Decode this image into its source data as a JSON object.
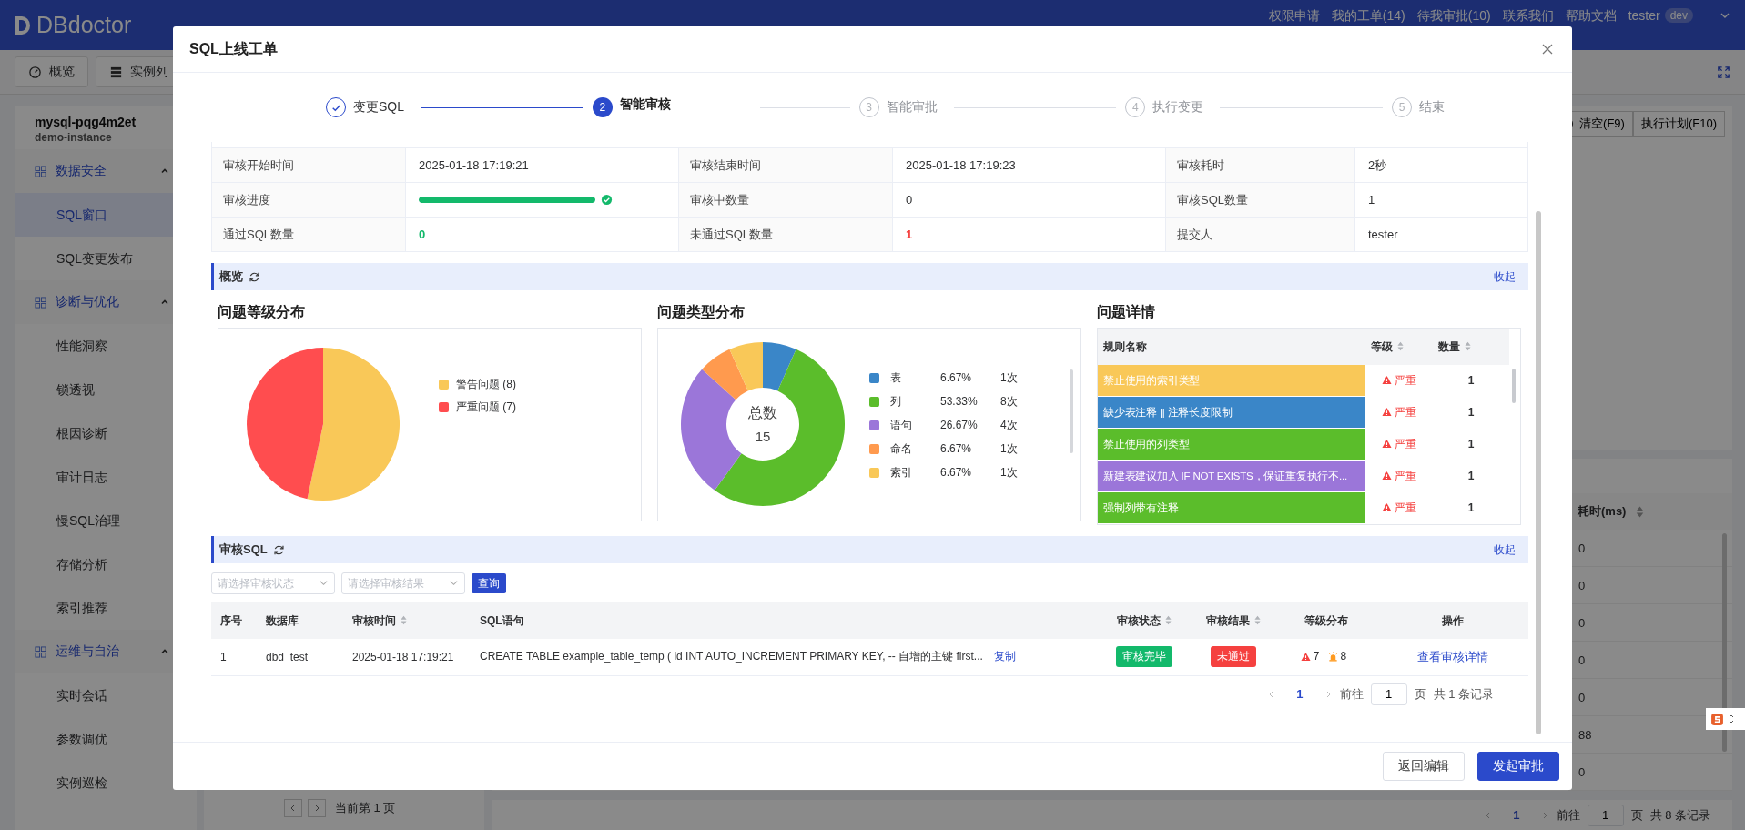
{
  "header": {
    "logo": "DBdoctor",
    "links": [
      "权限申请",
      "我的工单(14)",
      "待我审批(10)",
      "联系我们",
      "帮助文档"
    ],
    "user": "tester",
    "env": "dev"
  },
  "nav_tabs": [
    {
      "label": "概览",
      "selected": false
    },
    {
      "label": "实例列",
      "selected": false
    }
  ],
  "sidebar": {
    "instance": "mysql-pqg4m2et",
    "subtitle": "demo-instance",
    "groups": [
      {
        "label": "数据安全",
        "expanded": true,
        "children": [
          {
            "label": "SQL窗口",
            "selected": true
          },
          {
            "label": "SQL变更发布",
            "selected": false
          }
        ]
      },
      {
        "label": "诊断与优化",
        "expanded": true,
        "children": [
          {
            "label": "性能洞察",
            "selected": false
          },
          {
            "label": "锁透视",
            "selected": false
          },
          {
            "label": "根因诊断",
            "selected": false
          },
          {
            "label": "审计日志",
            "selected": false
          },
          {
            "label": "慢SQL治理",
            "selected": false
          },
          {
            "label": "存储分析",
            "selected": false
          },
          {
            "label": "索引推荐",
            "selected": false
          }
        ]
      },
      {
        "label": "运维与自治",
        "expanded": true,
        "children": [
          {
            "label": "实时会话",
            "selected": false
          },
          {
            "label": "参数调优",
            "selected": false
          },
          {
            "label": "实例巡检",
            "selected": false
          }
        ]
      }
    ]
  },
  "left_pager": {
    "text": "当前第 1 页"
  },
  "workspace": {
    "buttons": [
      "清空(F9)",
      "执行计划(F10)"
    ],
    "column": "耗时(ms)",
    "values": [
      "0",
      "0",
      "0",
      "0",
      "0",
      "88",
      "0"
    ],
    "pager": {
      "page": "1",
      "goto": "前往",
      "input": "1",
      "unit": "页",
      "total": "共 8 条记录"
    }
  },
  "dialog": {
    "title": "SQL上线工单",
    "steps": [
      {
        "label": "变更SQL",
        "done": true,
        "selected": false
      },
      {
        "number": "2",
        "label": "智能审核",
        "done": false,
        "selected": true
      },
      {
        "number": "3",
        "label": "智能审批",
        "done": false,
        "selected": false
      },
      {
        "number": "4",
        "label": "执行变更",
        "done": false,
        "selected": false
      },
      {
        "number": "5",
        "label": "结束",
        "done": false,
        "selected": false
      }
    ],
    "audit_info": [
      [
        {
          "label": "审核开始时间",
          "value": "2025-01-18 17:19:21"
        },
        {
          "label": "审核结束时间",
          "value": "2025-01-18 17:19:23"
        },
        {
          "label": "审核耗时",
          "value": "2秒"
        }
      ],
      [
        {
          "label": "审核进度",
          "kind": "progress",
          "level": 1
        },
        {
          "label": "审核中数量",
          "value": "0"
        },
        {
          "label": "审核SQL数量",
          "value": "1"
        }
      ],
      [
        {
          "label": "通过SQL数量",
          "value": "0",
          "kind": "success"
        },
        {
          "label": "未通过SQL数量",
          "value": "1",
          "kind": "danger"
        },
        {
          "label": "提交人",
          "value": "tester"
        }
      ]
    ],
    "overview": {
      "title": "概览",
      "collapse": "收起",
      "level_chart": {
        "title": "问题等级分布",
        "chart_data": {
          "type": "pie",
          "categories": [
            "警告问题 (8)",
            "严重问题 (7)"
          ],
          "values": [
            8,
            7
          ]
        },
        "legend": [
          {
            "color": "#f9c858"
          },
          {
            "color": "#ff4d4f"
          }
        ]
      },
      "type_chart": {
        "title": "问题类型分布",
        "center_label": "总数",
        "center_value": "15",
        "chart_data": {
          "type": "donut",
          "categories": [
            "表",
            "列",
            "语句",
            "命名",
            "索引"
          ],
          "values": [
            6.67,
            53.33,
            26.67,
            6.67,
            6.66
          ]
        },
        "legend": [
          {
            "color": "#3a86c8",
            "percent": "6.67%",
            "count": "1次"
          },
          {
            "color": "#5bbd2b",
            "percent": "53.33%",
            "count": "8次"
          },
          {
            "color": "#9b76d9",
            "percent": "26.67%",
            "count": "4次"
          },
          {
            "color": "#ff9a4e",
            "percent": "6.67%",
            "count": "1次"
          },
          {
            "color": "#f9c858",
            "percent": "6.67%",
            "count": "1次"
          }
        ]
      },
      "issues": {
        "title": "问题详情",
        "columns": [
          {
            "label": "规则名称",
            "sortable": false
          },
          {
            "label": "等级",
            "sortable": true
          },
          {
            "label": "数量",
            "sortable": true
          }
        ],
        "rows": [
          {
            "name": "禁止使用的索引类型",
            "color": "#f9c858",
            "level": "严重",
            "count": "1"
          },
          {
            "name": "缺少表注释 || 注释长度限制",
            "color": "#3a86c8",
            "level": "严重",
            "count": "1"
          },
          {
            "name": "禁止使用的列类型",
            "color": "#5bbd2b",
            "level": "严重",
            "count": "1"
          },
          {
            "name": "新建表建议加入 IF NOT EXISTS，保证重复执行不...",
            "color": "#9b76d9",
            "level": "严重",
            "count": "1"
          },
          {
            "name": "强制列带有注释",
            "color": "#5bbd2b",
            "level": "严重",
            "count": "1"
          }
        ]
      }
    },
    "audit_sql": {
      "title": "审核SQL",
      "collapse": "收起",
      "filters": [
        {
          "placeholder": "请选择审核状态"
        },
        {
          "placeholder": "请选择审核结果"
        }
      ],
      "query": "查询",
      "columns": [
        {
          "label": "序号",
          "sortable": false
        },
        {
          "label": "数据库",
          "sortable": false
        },
        {
          "label": "审核时间",
          "sortable": true
        },
        {
          "label": "SQL语句",
          "sortable": false
        },
        {
          "label": "审核状态",
          "sortable": true
        },
        {
          "label": "审核结果",
          "sortable": true
        },
        {
          "label": "等级分布",
          "sortable": false
        },
        {
          "label": "操作",
          "sortable": false
        }
      ],
      "rows": [
        {
          "index": "1",
          "database": "dbd_test",
          "time": "2025-01-18 17:19:21",
          "sql": "CREATE TABLE example_table_temp ( id INT AUTO_INCREMENT PRIMARY KEY, -- 自增的主键 first...",
          "copy": "复制",
          "status": {
            "text": "审核完毕",
            "kind": "success"
          },
          "result": {
            "text": "未通过",
            "kind": "danger"
          },
          "levels": [
            {
              "kind": "error",
              "count": "7"
            },
            {
              "kind": "warning",
              "count": "8"
            }
          ],
          "action": "查看审核详情"
        }
      ],
      "pager": {
        "page": "1",
        "goto": "前往",
        "input": "1",
        "unit": "页",
        "total": "共 1 条记录"
      }
    },
    "footer": [
      {
        "label": "返回编辑",
        "kind": "default"
      },
      {
        "label": "发起审批",
        "kind": "primary"
      }
    ]
  }
}
